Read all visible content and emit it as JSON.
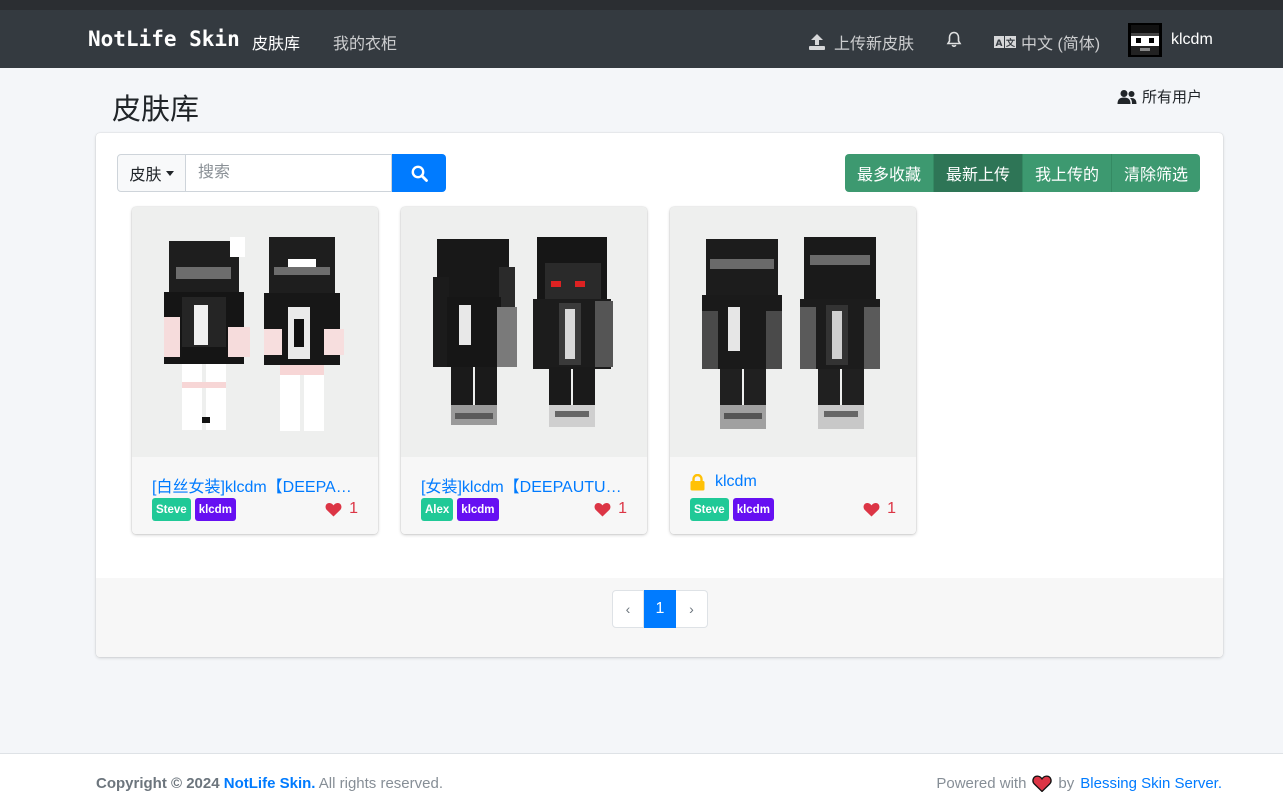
{
  "navbar": {
    "brand": "NotLife Skin",
    "links": [
      {
        "label": "皮肤库",
        "active": true
      },
      {
        "label": "我的衣柜",
        "active": false
      }
    ],
    "upload_label": "上传新皮肤",
    "language_label": "中文 (简体)",
    "username": "klcdm"
  },
  "page": {
    "title": "皮肤库",
    "all_users_label": "所有用户"
  },
  "filters": {
    "type_label": "皮肤",
    "search_placeholder": "搜索",
    "sort_buttons": [
      {
        "label": "最多收藏",
        "active": false
      },
      {
        "label": "最新上传",
        "active": true
      },
      {
        "label": "我上传的",
        "active": false
      },
      {
        "label": "清除筛选",
        "active": false
      }
    ]
  },
  "skins": [
    {
      "name": "[白丝女装]klcdm【DEEPAUTUMN】",
      "model": "Steve",
      "uploader": "klcdm",
      "likes": "1",
      "private": false
    },
    {
      "name": "[女装]klcdm【DEEPAUTUMN】",
      "model": "Alex",
      "uploader": "klcdm",
      "likes": "1",
      "private": false
    },
    {
      "name": "klcdm",
      "model": "Steve",
      "uploader": "klcdm",
      "likes": "1",
      "private": true
    }
  ],
  "pagination": {
    "prev": "‹",
    "current": "1",
    "next": "›"
  },
  "footer": {
    "copyright_prefix": "Copyright © 2024",
    "site_name": "NotLife Skin.",
    "rights": "All rights reserved.",
    "powered_prefix": "Powered with",
    "powered_by": "by",
    "powered_link": "Blessing Skin Server."
  },
  "colors": {
    "navbar": "#343a40",
    "primary": "#007bff",
    "sort_green": "#3d9970",
    "model_badge": "#20c997",
    "uploader_badge": "#6610f2",
    "heart": "#dc3545"
  },
  "icons": [
    "upload-icon",
    "bell-icon",
    "language-icon",
    "users-icon",
    "search-icon",
    "lock-icon",
    "heart-icon"
  ]
}
